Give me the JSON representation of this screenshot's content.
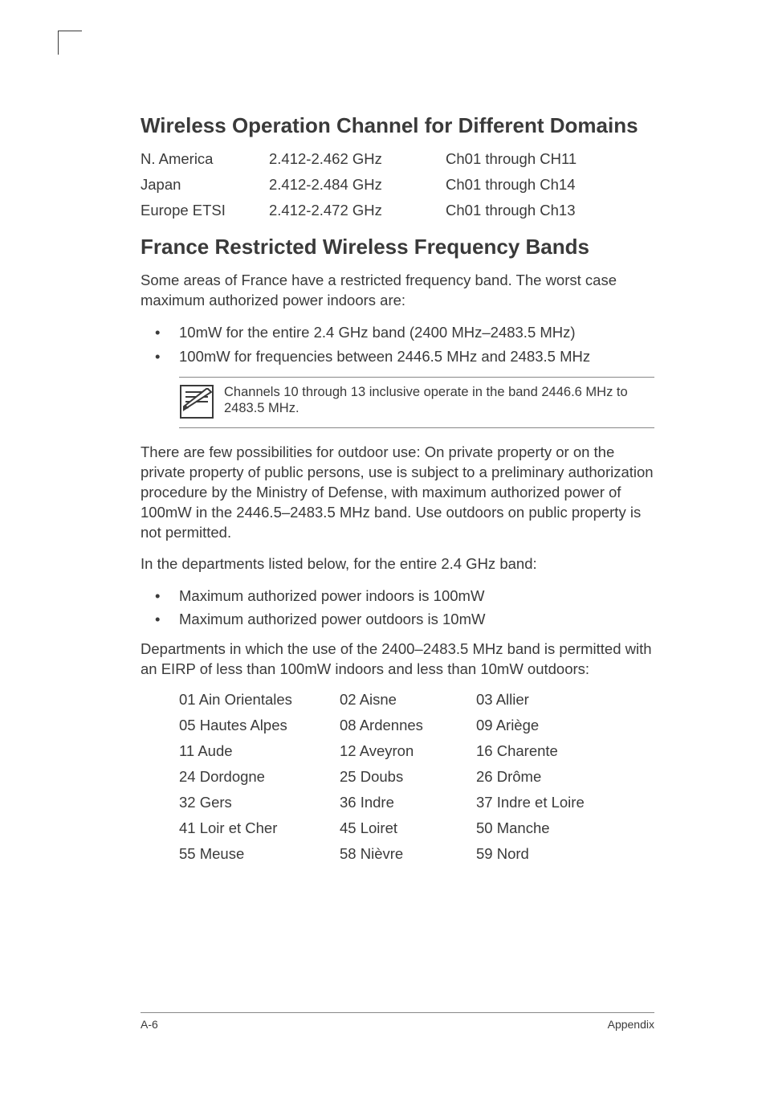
{
  "section1": {
    "title": "Wireless Operation Channel for Different Domains",
    "rows": [
      {
        "region": "N. America",
        "freq": "2.412-2.462 GHz",
        "ch": "Ch01 through CH11"
      },
      {
        "region": "Japan",
        "freq": "2.412-2.484 GHz",
        "ch": "Ch01 through Ch14"
      },
      {
        "region": "Europe ETSI",
        "freq": "2.412-2.472 GHz",
        "ch": "Ch01 through Ch13"
      }
    ]
  },
  "section2": {
    "title": "France Restricted Wireless Frequency Bands",
    "intro": "Some areas of France have a restricted frequency band. The worst case maximum authorized power indoors are:",
    "bullets1": [
      "10mW for the entire 2.4 GHz band (2400 MHz–2483.5 MHz)",
      "100mW for frequencies between 2446.5 MHz and 2483.5 MHz"
    ],
    "note": "Channels 10 through 13 inclusive operate in the band 2446.6 MHz to 2483.5 MHz.",
    "para2": "There are few possibilities for outdoor use: On private property or on the private property of public persons, use is subject to a preliminary authorization procedure by the Ministry of Defense, with maximum authorized power of 100mW in the 2446.5–2483.5 MHz band. Use outdoors on public property is not permitted.",
    "para3": "In the departments listed below, for the entire 2.4 GHz band:",
    "bullets2": [
      "Maximum authorized power indoors is 100mW",
      "Maximum authorized power outdoors is 10mW"
    ],
    "para4": "Departments in which the use of the 2400–2483.5 MHz band is permitted with an EIRP of less than 100mW indoors and less than 10mW outdoors:",
    "departments": [
      {
        "a": "01  Ain Orientales",
        "b": "02  Aisne",
        "c": "03  Allier"
      },
      {
        "a": "05  Hautes Alpes",
        "b": "08  Ardennes",
        "c": "09  Ariège"
      },
      {
        "a": "11  Aude",
        "b": "12  Aveyron",
        "c": "16  Charente"
      },
      {
        "a": "24  Dordogne",
        "b": "25  Doubs",
        "c": "26  Drôme"
      },
      {
        "a": "32  Gers",
        "b": "36  Indre",
        "c": "37  Indre et Loire"
      },
      {
        "a": "41  Loir et Cher",
        "b": "45  Loiret",
        "c": "50  Manche"
      },
      {
        "a": "55  Meuse",
        "b": "58  Nièvre",
        "c": "59  Nord"
      }
    ]
  },
  "footer": {
    "left": "A-6",
    "right": "Appendix"
  }
}
